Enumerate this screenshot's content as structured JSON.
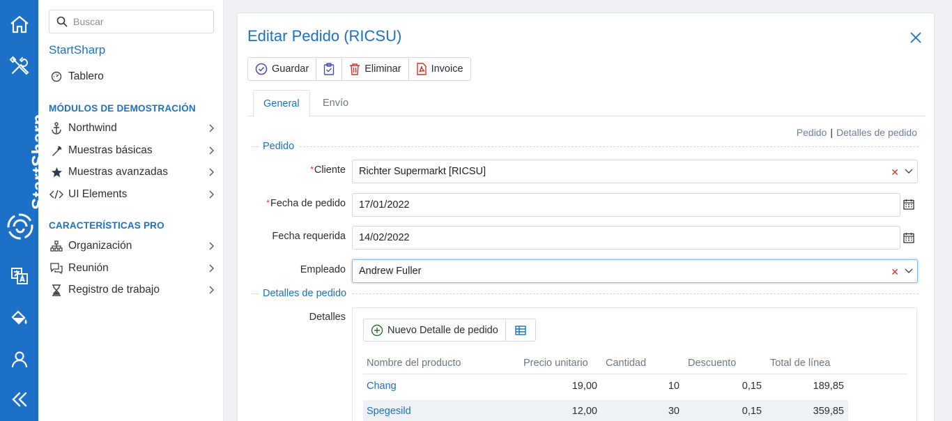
{
  "rail": {
    "brand_text": "StartSharp",
    "icons": [
      "home-icon",
      "tools-icon",
      "logo-icon",
      "translate-icon",
      "paint-bucket-icon",
      "user-icon",
      "collapse-icon"
    ]
  },
  "sidebar": {
    "search_placeholder": "Buscar",
    "title": "StartSharp",
    "dashboard_label": "Tablero",
    "section_demo": "MÓDULOS DE DEMOSTRACIÓN",
    "demo_items": [
      {
        "label": "Northwind",
        "icon": "anchor-icon"
      },
      {
        "label": "Muestras básicas",
        "icon": "wrench-icon"
      },
      {
        "label": "Muestras avanzadas",
        "icon": "star-icon"
      },
      {
        "label": "UI Elements",
        "icon": "code-icon"
      }
    ],
    "section_pro": "CARACTERÍSTICAS PRO",
    "pro_items": [
      {
        "label": "Organización",
        "icon": "org-chart-icon"
      },
      {
        "label": "Reunión",
        "icon": "chat-icon"
      },
      {
        "label": "Registro de trabajo",
        "icon": "hourglass-icon"
      }
    ]
  },
  "dialog": {
    "title": "Editar Pedido (RICSU)",
    "toolbar": {
      "save": "Guardar",
      "delete": "Eliminar",
      "invoice": "Invoice"
    },
    "tabs": [
      "General",
      "Envío"
    ],
    "crumbs": {
      "order": "Pedido",
      "sep": "|",
      "details": "Detalles de pedido"
    },
    "cat_order": "Pedido",
    "cat_details": "Detalles de pedido",
    "fields": {
      "client_label": "Cliente",
      "client_value": "Richter Supermarkt [RICSU]",
      "order_date_label": "Fecha de pedido",
      "order_date_value": "17/01/2022",
      "required_date_label": "Fecha requerida",
      "required_date_value": "14/02/2022",
      "employee_label": "Empleado",
      "employee_value": "Andrew Fuller",
      "details_label": "Detalles",
      "required_mark": "*"
    },
    "grid": {
      "new_button": "Nuevo Detalle de pedido",
      "columns": [
        "Nombre del producto",
        "Precio unitario",
        "Cantidad",
        "Descuento",
        "Total de línea"
      ],
      "rows": [
        {
          "product": "Chang",
          "price": "19,00",
          "qty": "10",
          "discount": "0,15",
          "total": "189,85"
        },
        {
          "product": "Spegesild",
          "price": "12,00",
          "qty": "30",
          "discount": "0,15",
          "total": "359,85"
        }
      ]
    }
  },
  "colors": {
    "accent": "#1c70c8",
    "required": "#d9302c",
    "rail_bg": "#1c70c8"
  }
}
